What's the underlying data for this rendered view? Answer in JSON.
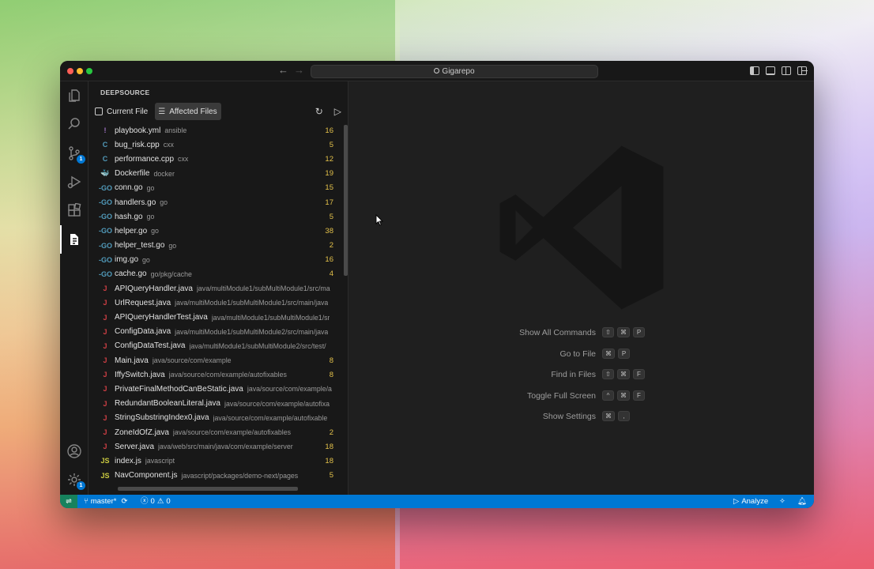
{
  "window": {
    "title": "Gigarepo"
  },
  "activity_bar": {
    "items": [
      {
        "name": "explorer-icon"
      },
      {
        "name": "search-icon"
      },
      {
        "name": "source-control-icon",
        "badge": "1"
      },
      {
        "name": "run-debug-icon"
      },
      {
        "name": "extensions-icon"
      },
      {
        "name": "deepsource-icon"
      }
    ],
    "accounts": {
      "name": "accounts-icon"
    },
    "manage": {
      "name": "gear-icon",
      "badge": "1"
    }
  },
  "sidebar": {
    "title": "DEEPSOURCE",
    "tabs": [
      {
        "label": "Current File",
        "active": false
      },
      {
        "label": "Affected Files",
        "active": true
      }
    ],
    "files": [
      {
        "icon": "!",
        "color": "#a074c4",
        "name": "playbook.yml",
        "path": "ansible",
        "count": "16"
      },
      {
        "icon": "C",
        "color": "#519aba",
        "name": "bug_risk.cpp",
        "path": "cxx",
        "count": "5"
      },
      {
        "icon": "C",
        "color": "#519aba",
        "name": "performance.cpp",
        "path": "cxx",
        "count": "12"
      },
      {
        "icon": "🐳",
        "color": "#519aba",
        "name": "Dockerfile",
        "path": "docker",
        "count": "19"
      },
      {
        "icon": "-GO",
        "color": "#519aba",
        "name": "conn.go",
        "path": "go",
        "count": "15"
      },
      {
        "icon": "-GO",
        "color": "#519aba",
        "name": "handlers.go",
        "path": "go",
        "count": "17"
      },
      {
        "icon": "-GO",
        "color": "#519aba",
        "name": "hash.go",
        "path": "go",
        "count": "5"
      },
      {
        "icon": "-GO",
        "color": "#519aba",
        "name": "helper.go",
        "path": "go",
        "count": "38"
      },
      {
        "icon": "-GO",
        "color": "#519aba",
        "name": "helper_test.go",
        "path": "go",
        "count": "2"
      },
      {
        "icon": "-GO",
        "color": "#519aba",
        "name": "img.go",
        "path": "go",
        "count": "16"
      },
      {
        "icon": "-GO",
        "color": "#519aba",
        "name": "cache.go",
        "path": "go/pkg/cache",
        "count": "4"
      },
      {
        "icon": "J",
        "color": "#cc3e44",
        "name": "APIQueryHandler.java",
        "path": "java/multiModule1/subMultiModule1/src/ma",
        "count": ""
      },
      {
        "icon": "J",
        "color": "#cc3e44",
        "name": "UrlRequest.java",
        "path": "java/multiModule1/subMultiModule1/src/main/java",
        "count": ""
      },
      {
        "icon": "J",
        "color": "#cc3e44",
        "name": "APIQueryHandlerTest.java",
        "path": "java/multiModule1/subMultiModule1/sr",
        "count": ""
      },
      {
        "icon": "J",
        "color": "#cc3e44",
        "name": "ConfigData.java",
        "path": "java/multiModule1/subMultiModule2/src/main/java",
        "count": ""
      },
      {
        "icon": "J",
        "color": "#cc3e44",
        "name": "ConfigDataTest.java",
        "path": "java/multiModule1/subMultiModule2/src/test/",
        "count": ""
      },
      {
        "icon": "J",
        "color": "#cc3e44",
        "name": "Main.java",
        "path": "java/source/com/example",
        "count": "8"
      },
      {
        "icon": "J",
        "color": "#cc3e44",
        "name": "IffySwitch.java",
        "path": "java/source/com/example/autofixables",
        "count": "8"
      },
      {
        "icon": "J",
        "color": "#cc3e44",
        "name": "PrivateFinalMethodCanBeStatic.java",
        "path": "java/source/com/example/a",
        "count": ""
      },
      {
        "icon": "J",
        "color": "#cc3e44",
        "name": "RedundantBooleanLiteral.java",
        "path": "java/source/com/example/autofixa",
        "count": ""
      },
      {
        "icon": "J",
        "color": "#cc3e44",
        "name": "StringSubstringIndex0.java",
        "path": "java/source/com/example/autofixable",
        "count": ""
      },
      {
        "icon": "J",
        "color": "#cc3e44",
        "name": "ZoneIdOfZ.java",
        "path": "java/source/com/example/autofixables",
        "count": "2"
      },
      {
        "icon": "J",
        "color": "#cc3e44",
        "name": "Server.java",
        "path": "java/web/src/main/java/com/example/server",
        "count": "18"
      },
      {
        "icon": "JS",
        "color": "#cbcb41",
        "name": "index.js",
        "path": "javascript",
        "count": "18"
      },
      {
        "icon": "JS",
        "color": "#cbcb41",
        "name": "NavComponent.js",
        "path": "javascript/packages/demo-next/pages",
        "count": "5"
      }
    ]
  },
  "editor": {
    "shortcuts": [
      {
        "label": "Show All Commands",
        "keys": [
          "⇧",
          "⌘",
          "P"
        ]
      },
      {
        "label": "Go to File",
        "keys": [
          "⌘",
          "P"
        ]
      },
      {
        "label": "Find in Files",
        "keys": [
          "⇧",
          "⌘",
          "F"
        ]
      },
      {
        "label": "Toggle Full Screen",
        "keys": [
          "^",
          "⌘",
          "F"
        ]
      },
      {
        "label": "Show Settings",
        "keys": [
          "⌘",
          ","
        ]
      }
    ]
  },
  "statusbar": {
    "remote_icon": "remote-icon",
    "branch": "master*",
    "errors": "0",
    "warnings": "0",
    "analyze_label": "Analyze",
    "colors": {
      "bar": "#0078d4",
      "remote": "#16825d"
    }
  }
}
